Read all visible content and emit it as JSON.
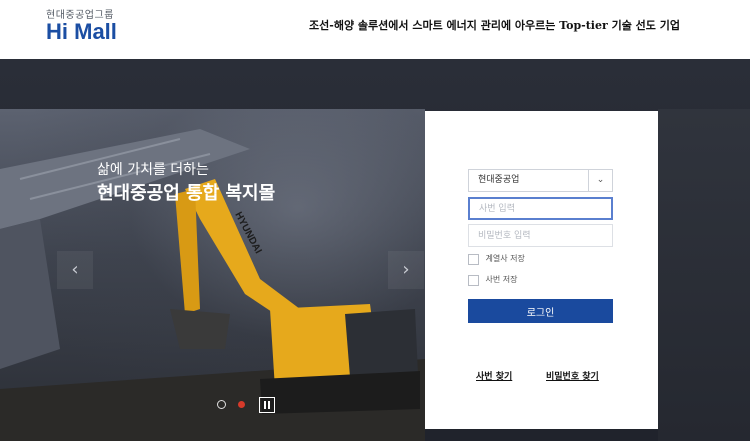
{
  "header": {
    "logo_sub": "현대중공업그룹",
    "logo_main": "Hi Mall",
    "tagline": "조선-해양 솔루션에서 스마트 에너지 관리에 아우르는 Top-tier 기술 선도 기업"
  },
  "hero": {
    "line1": "삶에 가치를 더하는",
    "line2": "현대중공업 통합 복지몰",
    "prev_arrow": "‹",
    "next_arrow": "›",
    "slide_count": 2,
    "active_slide": 2
  },
  "login": {
    "company_selected": "현대중공업",
    "company_arrow": "⌄",
    "id_placeholder": "사번 입력",
    "pw_placeholder": "비밀번호 입력",
    "save_company_label": "계열사 저장",
    "save_id_label": "사번 저장",
    "login_button": "로그인",
    "find_id_link": "사번 찾기",
    "find_pw_link": "비밀번호 찾기"
  },
  "colors": {
    "brand_blue": "#1b4ea3",
    "button_blue": "#1a4a9e",
    "active_dot": "#d63a2a",
    "machine_yellow": "#e6a91c"
  }
}
